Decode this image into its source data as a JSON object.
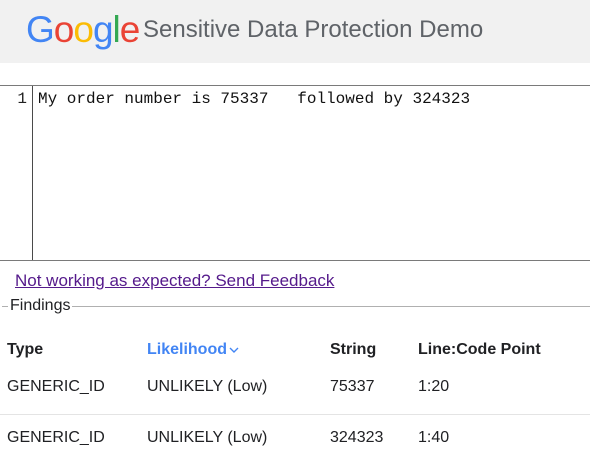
{
  "header": {
    "logo": "Google",
    "title": "Sensitive Data Protection Demo"
  },
  "editor": {
    "line_number": "1",
    "text": "My order number is 75337   followed by 324323"
  },
  "feedback_link": "Not working as expected? Send Feedback",
  "findings": {
    "legend": "Findings",
    "columns": [
      "Type",
      "Likelihood",
      "String",
      "Line:Code Point"
    ],
    "sorted_column": "Likelihood",
    "rows": [
      [
        "GENERIC_ID",
        "UNLIKELY (Low)",
        "75337",
        "1:20"
      ],
      [
        "GENERIC_ID",
        "UNLIKELY (Low)",
        "324323",
        "1:40"
      ]
    ]
  },
  "colors": {
    "header_bg": "#f1f1f1",
    "link": "#551a8b",
    "sorted_header": "#4285f4",
    "google_blue": "#4285f4",
    "google_red": "#ea4335",
    "google_yellow": "#fbbc05",
    "google_green": "#34a853"
  },
  "icons": {
    "sort": "chevron-down-icon"
  }
}
